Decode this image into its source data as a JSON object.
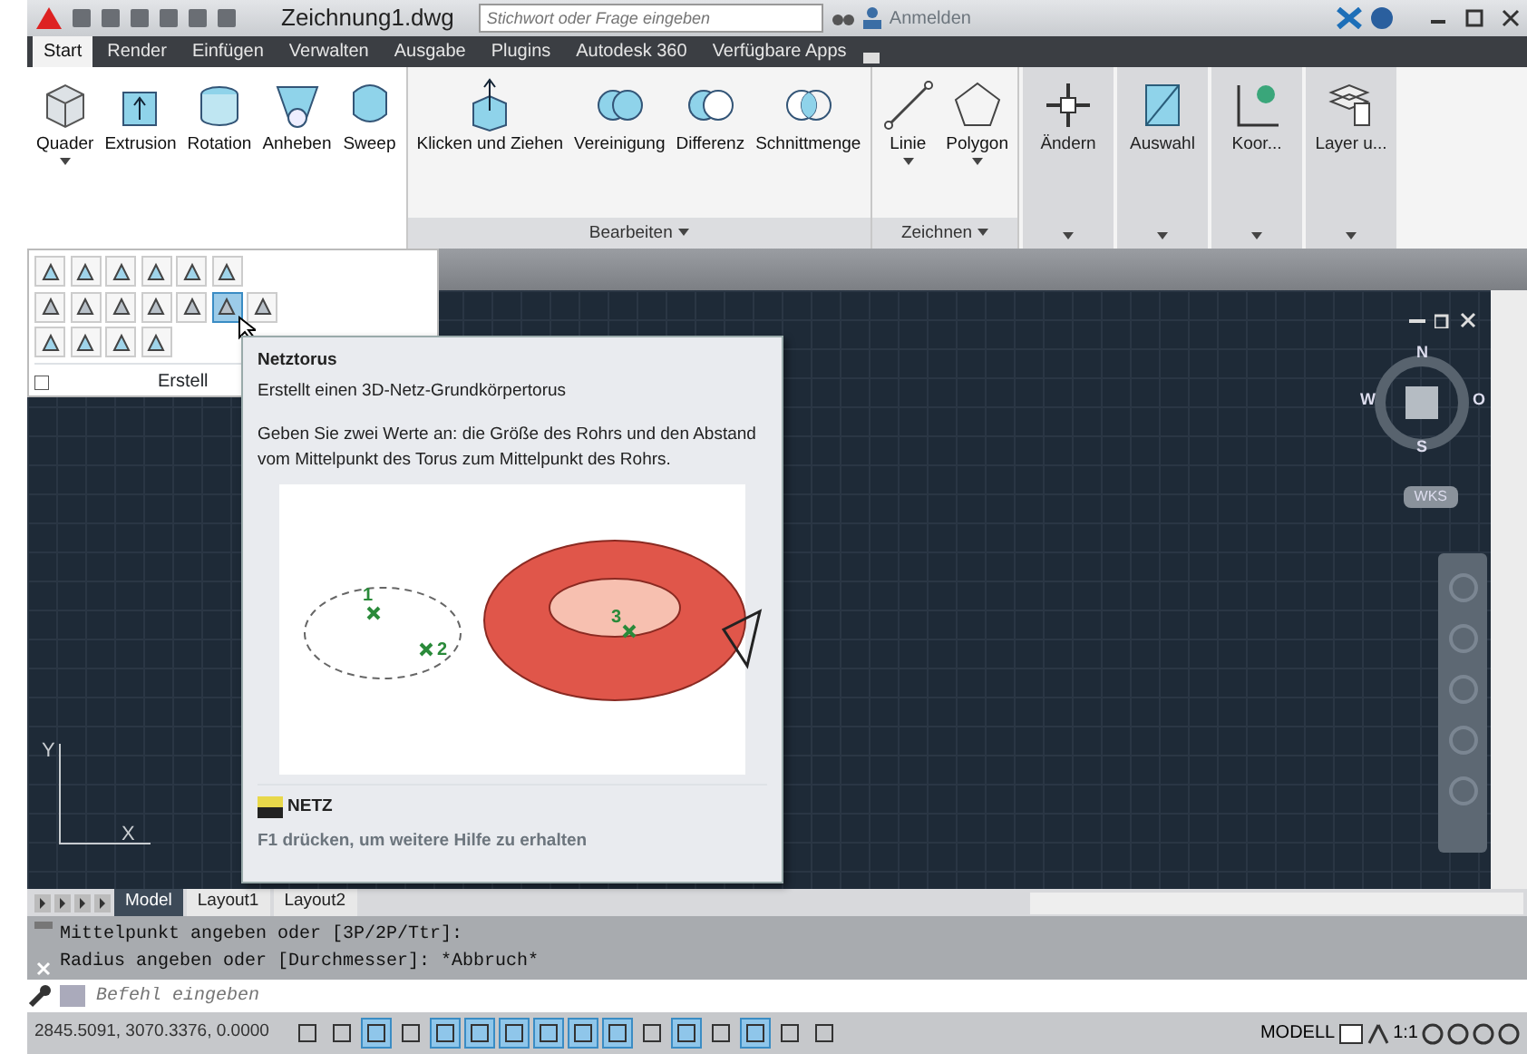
{
  "title_bar": {
    "title": "Zeichnung1.dwg",
    "search": {
      "placeholder": "Stichwort oder Frage eingeben"
    },
    "sign_in": "Anmelden"
  },
  "ribbon_tabs": [
    {
      "label": "Start",
      "selected": true
    },
    {
      "label": "Render",
      "selected": false
    },
    {
      "label": "Einfügen",
      "selected": false
    },
    {
      "label": "Verwalten",
      "selected": false
    },
    {
      "label": "Ausgabe",
      "selected": false
    },
    {
      "label": "Plugins",
      "selected": false
    },
    {
      "label": "Autodesk 360",
      "selected": false
    },
    {
      "label": "Verfügbare Apps",
      "selected": false
    }
  ],
  "ribbon": {
    "panels": [
      {
        "buttons": [
          {
            "label": "Quader",
            "menu": true
          },
          {
            "label": "Extrusion",
            "menu": false
          },
          {
            "label": "Rotation",
            "menu": false
          },
          {
            "label": "Anheben",
            "menu": false
          },
          {
            "label": "Sweep",
            "menu": false
          }
        ]
      },
      {
        "title": "Bearbeiten",
        "buttons": [
          {
            "label": "Klicken und Ziehen",
            "menu": false
          },
          {
            "label": "Vereinigung",
            "menu": false
          },
          {
            "label": "Differenz",
            "menu": false
          },
          {
            "label": "Schnittmenge",
            "menu": false
          }
        ]
      },
      {
        "title": "Zeichnen",
        "buttons": [
          {
            "label": "Linie",
            "menu": true
          },
          {
            "label": "Polygon",
            "menu": true
          }
        ]
      }
    ],
    "collapsed_panels": [
      {
        "label": "Ändern"
      },
      {
        "label": "Auswahl"
      },
      {
        "label": "Koor..."
      },
      {
        "label": "Layer u..."
      }
    ]
  },
  "dropdown_panel": {
    "title": "Erstell",
    "tool_rows": [
      [
        {
          "selected": false
        },
        {
          "selected": false
        },
        {
          "selected": false
        },
        {
          "selected": false
        },
        {
          "selected": false
        },
        {
          "selected": false
        }
      ],
      [
        {
          "selected": false
        },
        {
          "selected": false
        },
        {
          "selected": false
        },
        {
          "selected": false
        },
        {
          "selected": false
        },
        {
          "selected": true
        },
        {
          "selected": false
        }
      ],
      [
        {
          "selected": false
        },
        {
          "selected": false
        },
        {
          "selected": false
        },
        {
          "selected": false
        }
      ]
    ]
  },
  "tooltip": {
    "title": "Netztorus",
    "summary": "Erstellt einen 3D-Netz-Grundkörpertorus",
    "description": "Geben Sie zwei Werte an: die Größe des Rohrs und den Abstand vom Mittelpunkt des Torus zum Mittelpunkt des Rohrs.",
    "diagram_labels": [
      "1",
      "2",
      "3"
    ],
    "command": "NETZ",
    "help": "F1 drücken, um weitere Hilfe zu erhalten"
  },
  "viewcube": {
    "north": "N",
    "south": "S",
    "west": "W",
    "east": "O",
    "ucs": "WKS"
  },
  "ucs_icon": {
    "y": "Y",
    "x": "X"
  },
  "layout_tabs": [
    {
      "label": "Model",
      "selected": true
    },
    {
      "label": "Layout1",
      "selected": false
    },
    {
      "label": "Layout2",
      "selected": false
    }
  ],
  "command_history": [
    "Mittelpunkt angeben oder [3P/2P/Ttr]:",
    "Radius angeben oder [Durchmesser]: *Abbruch*"
  ],
  "command_input": {
    "placeholder": "Befehl eingeben"
  },
  "status_bar": {
    "coordinates": "2845.5091, 3070.3376, 0.0000",
    "toggles": [
      {
        "on": false
      },
      {
        "on": false
      },
      {
        "on": true
      },
      {
        "on": false
      },
      {
        "on": true
      },
      {
        "on": true
      },
      {
        "on": true
      },
      {
        "on": true
      },
      {
        "on": true
      },
      {
        "on": true
      },
      {
        "on": false
      },
      {
        "on": true
      },
      {
        "on": false
      },
      {
        "on": true
      },
      {
        "on": false
      },
      {
        "on": false
      }
    ],
    "space": "MODELL",
    "scale": "1:1"
  }
}
